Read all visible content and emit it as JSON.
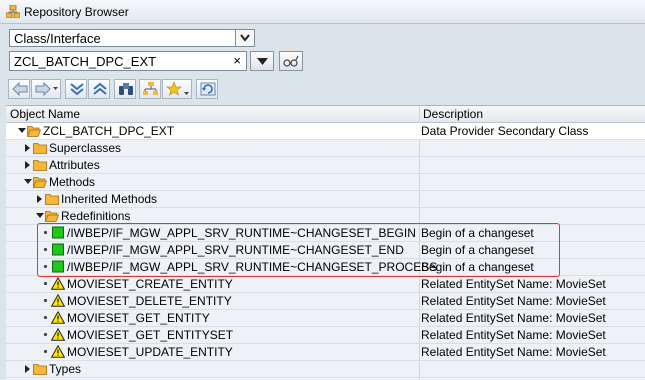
{
  "window": {
    "title": "Repository Browser"
  },
  "object_type": {
    "selected": "Class/Interface"
  },
  "object_name": {
    "value": "ZCL_BATCH_DPC_EXT",
    "clear_glyph": "×"
  },
  "columns": {
    "name": "Object Name",
    "description": "Description"
  },
  "tree": [
    {
      "label": "ZCL_BATCH_DPC_EXT",
      "description": "Data Provider Secondary Class",
      "icon": "folder-open-icon",
      "state": "expanded",
      "level": 0
    },
    {
      "label": "Superclasses",
      "description": "",
      "icon": "folder-icon",
      "state": "collapsed",
      "level": 1
    },
    {
      "label": "Attributes",
      "description": "",
      "icon": "folder-icon",
      "state": "collapsed",
      "level": 1
    },
    {
      "label": "Methods",
      "description": "",
      "icon": "folder-open-icon",
      "state": "expanded",
      "level": 1
    },
    {
      "label": "Inherited Methods",
      "description": "",
      "icon": "folder-icon",
      "state": "collapsed",
      "level": 2
    },
    {
      "label": "Redefinitions",
      "description": "",
      "icon": "folder-open-icon",
      "state": "expanded",
      "level": 2
    },
    {
      "label": "/IWBEP/IF_MGW_APPL_SRV_RUNTIME~CHANGESET_BEGIN",
      "description": "Begin of a changeset",
      "icon": "green-square-icon",
      "state": "leaf",
      "level": 3
    },
    {
      "label": "/IWBEP/IF_MGW_APPL_SRV_RUNTIME~CHANGESET_END",
      "description": "Begin of a changeset",
      "icon": "green-square-icon",
      "state": "leaf",
      "level": 3
    },
    {
      "label": "/IWBEP/IF_MGW_APPL_SRV_RUNTIME~CHANGESET_PROCESS",
      "description": "Begin of a changeset",
      "icon": "green-square-icon",
      "state": "leaf",
      "level": 3
    },
    {
      "label": "MOVIESET_CREATE_ENTITY",
      "description": "Related EntitySet Name: MovieSet",
      "icon": "warning-triangle-icon",
      "state": "leaf",
      "level": 3
    },
    {
      "label": "MOVIESET_DELETE_ENTITY",
      "description": "Related EntitySet Name: MovieSet",
      "icon": "warning-triangle-icon",
      "state": "leaf",
      "level": 3
    },
    {
      "label": "MOVIESET_GET_ENTITY",
      "description": "Related EntitySet Name: MovieSet",
      "icon": "warning-triangle-icon",
      "state": "leaf",
      "level": 3
    },
    {
      "label": "MOVIESET_GET_ENTITYSET",
      "description": "Related EntitySet Name: MovieSet",
      "icon": "warning-triangle-icon",
      "state": "leaf",
      "level": 3
    },
    {
      "label": "MOVIESET_UPDATE_ENTITY",
      "description": "Related EntitySet Name: MovieSet",
      "icon": "warning-triangle-icon",
      "state": "leaf",
      "level": 3
    },
    {
      "label": "Types",
      "description": "",
      "icon": "folder-icon",
      "state": "collapsed",
      "level": 1
    }
  ],
  "colors": {
    "folder": "#f5b63a",
    "green": "#1ec61e",
    "warning": "#ffe600",
    "highlight_border": "#e0353a"
  }
}
